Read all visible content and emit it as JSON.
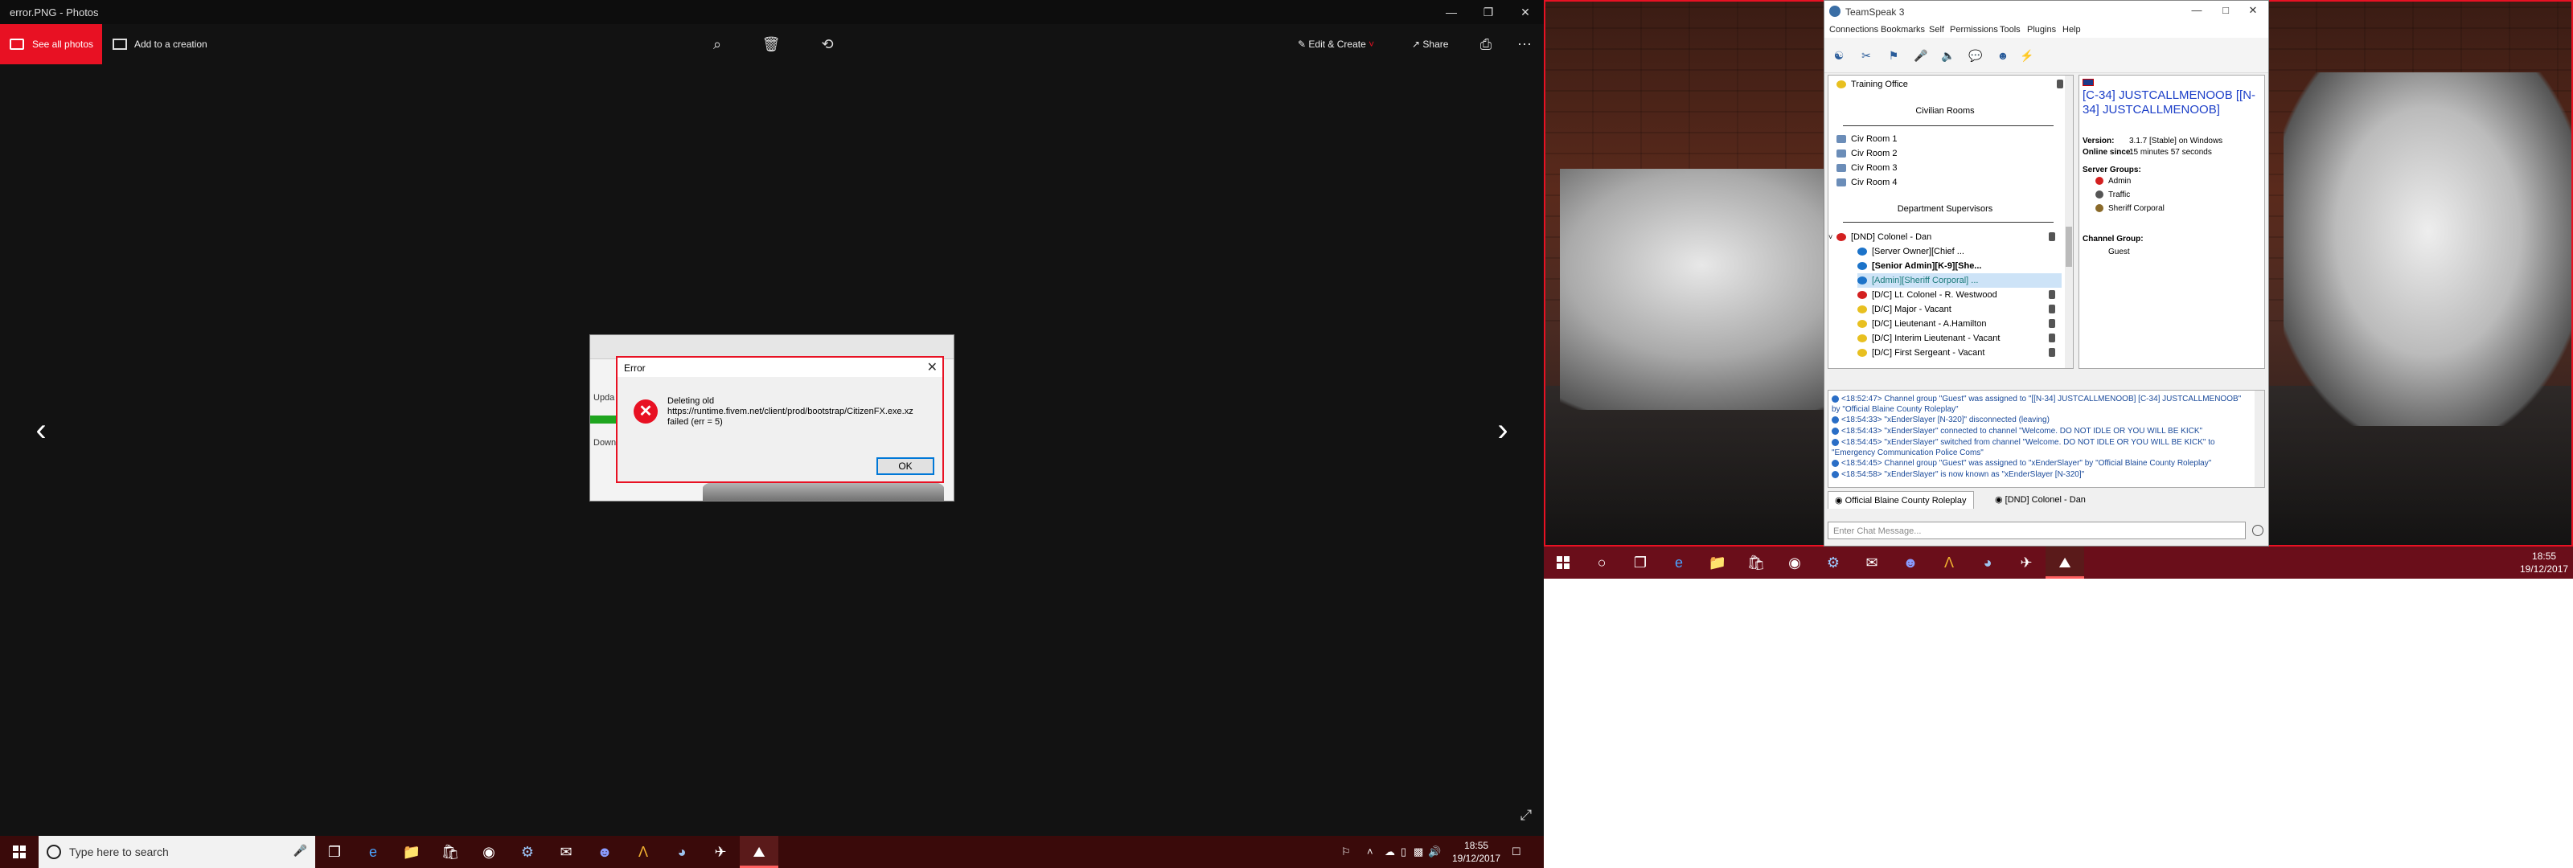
{
  "photos": {
    "window_title": "error.PNG - Photos",
    "see_all": "See all photos",
    "add_creation": "Add to a creation",
    "edit_create": "Edit & Create",
    "share": "Share",
    "icons": [
      "zoom-icon",
      "delete-icon",
      "rotate-icon",
      "edit-icon",
      "share-icon",
      "print-icon",
      "more-icon",
      "fullscreen-icon"
    ]
  },
  "error_dialog": {
    "title": "Error",
    "message": "Deleting old https://runtime.fivem.net/client/prod/bootstrap/CitizenFX.exe.xz failed (err = 5)",
    "ok": "OK",
    "bg_text_1": "Upda",
    "bg_text_2": "Down"
  },
  "taskbar_left": {
    "search_placeholder": "Type here to search",
    "time": "18:55",
    "date": "19/12/2017"
  },
  "teamspeak": {
    "window_title": "TeamSpeak 3",
    "menu": [
      "Connections",
      "Bookmarks",
      "Self",
      "Permissions",
      "Tools",
      "Plugins",
      "Help"
    ],
    "tree": {
      "training_office": "Training Office",
      "civilian_rooms": "Civilian Rooms",
      "civ_rooms": [
        "Civ Room 1",
        "Civ Room 2",
        "Civ Room 3",
        "Civ Room 4"
      ],
      "department_supervisors": "Department Supervisors",
      "colonel_channel": "[DND] Colonel - Dan",
      "users": [
        "[Server Owner][Chief ...",
        "[Senior Admin][K-9][She...",
        "[Admin][Sheriff Corporal] ..."
      ],
      "ranks": [
        "[D/C] Lt. Colonel - R. Westwood",
        "[D/C] Major - Vacant",
        "[D/C] Lieutenant - A.Hamilton",
        "[D/C] Interim Lieutenant - Vacant",
        "[D/C] First Sergeant - Vacant"
      ]
    },
    "info": {
      "name": "[C-34] JUSTCALLMENOOB [[N-34] JUSTCALLMENOOB]",
      "version_label": "Version:",
      "version": "3.1.7 [Stable] on Windows",
      "online_label": "Online since:",
      "online": "15 minutes 57 seconds",
      "server_groups_label": "Server Groups:",
      "server_groups": [
        "Admin",
        "Traffic",
        "Sheriff Corporal"
      ],
      "channel_group_label": "Channel Group:",
      "channel_group": "Guest"
    },
    "chat": [
      {
        "time": "<18:52:47>",
        "text": "Channel group \"Guest\" was assigned to \"[[N-34] JUSTCALLMENOOB] [C-34] JUSTCALLMENOOB\" by \"Official Blaine County Roleplay\""
      },
      {
        "time": "<18:54:33>",
        "text": "\"xEnderSlayer [N-320]\" disconnected (leaving)"
      },
      {
        "time": "<18:54:43>",
        "text": "\"xEnderSlayer\" connected to channel \"Welcome. DO NOT IDLE OR YOU WILL BE KICK\""
      },
      {
        "time": "<18:54:45>",
        "text": "\"xEnderSlayer\" switched from channel \"Welcome. DO NOT IDLE OR YOU WILL BE KICK\" to \"Emergency Communication Police Coms\""
      },
      {
        "time": "<18:54:45>",
        "text": "Channel group \"Guest\" was assigned to \"xEnderSlayer\" by \"Official Blaine County Roleplay\""
      },
      {
        "time": "<18:54:58>",
        "text": "\"xEnderSlayer\" is now known as \"xEnderSlayer [N-320]\""
      }
    ],
    "tabs": [
      "Official Blaine County Roleplay",
      "[DND] Colonel - Dan"
    ],
    "input_placeholder": "Enter Chat Message..."
  },
  "taskbar_right": {
    "time": "18:55",
    "date": "19/12/2017"
  },
  "colors": {
    "accent_red": "#e81123",
    "taskbar_dark_red": "#6a0e1a",
    "ts_name_blue": "#1c3fc8"
  }
}
